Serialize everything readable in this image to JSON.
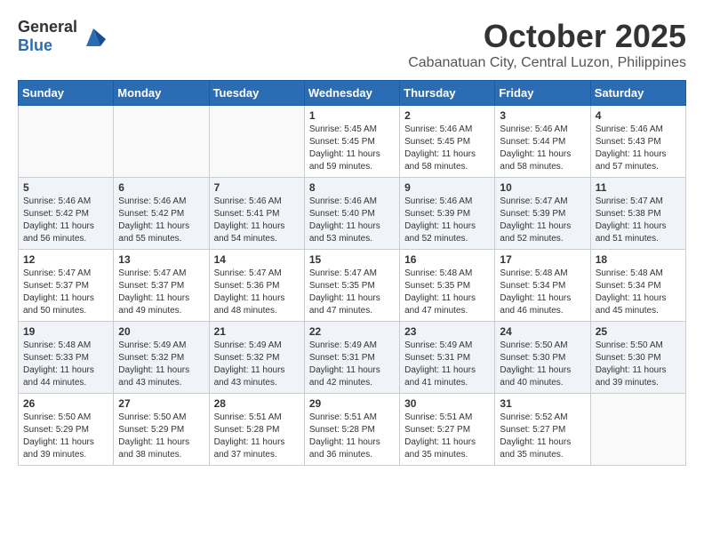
{
  "header": {
    "logo": {
      "general": "General",
      "blue": "Blue"
    },
    "month_title": "October 2025",
    "subtitle": "Cabanatuan City, Central Luzon, Philippines"
  },
  "calendar": {
    "days_of_week": [
      "Sunday",
      "Monday",
      "Tuesday",
      "Wednesday",
      "Thursday",
      "Friday",
      "Saturday"
    ],
    "weeks": [
      [
        {
          "day": "",
          "info": ""
        },
        {
          "day": "",
          "info": ""
        },
        {
          "day": "",
          "info": ""
        },
        {
          "day": "1",
          "info": "Sunrise: 5:45 AM\nSunset: 5:45 PM\nDaylight: 11 hours\nand 59 minutes."
        },
        {
          "day": "2",
          "info": "Sunrise: 5:46 AM\nSunset: 5:45 PM\nDaylight: 11 hours\nand 58 minutes."
        },
        {
          "day": "3",
          "info": "Sunrise: 5:46 AM\nSunset: 5:44 PM\nDaylight: 11 hours\nand 58 minutes."
        },
        {
          "day": "4",
          "info": "Sunrise: 5:46 AM\nSunset: 5:43 PM\nDaylight: 11 hours\nand 57 minutes."
        }
      ],
      [
        {
          "day": "5",
          "info": "Sunrise: 5:46 AM\nSunset: 5:42 PM\nDaylight: 11 hours\nand 56 minutes."
        },
        {
          "day": "6",
          "info": "Sunrise: 5:46 AM\nSunset: 5:42 PM\nDaylight: 11 hours\nand 55 minutes."
        },
        {
          "day": "7",
          "info": "Sunrise: 5:46 AM\nSunset: 5:41 PM\nDaylight: 11 hours\nand 54 minutes."
        },
        {
          "day": "8",
          "info": "Sunrise: 5:46 AM\nSunset: 5:40 PM\nDaylight: 11 hours\nand 53 minutes."
        },
        {
          "day": "9",
          "info": "Sunrise: 5:46 AM\nSunset: 5:39 PM\nDaylight: 11 hours\nand 52 minutes."
        },
        {
          "day": "10",
          "info": "Sunrise: 5:47 AM\nSunset: 5:39 PM\nDaylight: 11 hours\nand 52 minutes."
        },
        {
          "day": "11",
          "info": "Sunrise: 5:47 AM\nSunset: 5:38 PM\nDaylight: 11 hours\nand 51 minutes."
        }
      ],
      [
        {
          "day": "12",
          "info": "Sunrise: 5:47 AM\nSunset: 5:37 PM\nDaylight: 11 hours\nand 50 minutes."
        },
        {
          "day": "13",
          "info": "Sunrise: 5:47 AM\nSunset: 5:37 PM\nDaylight: 11 hours\nand 49 minutes."
        },
        {
          "day": "14",
          "info": "Sunrise: 5:47 AM\nSunset: 5:36 PM\nDaylight: 11 hours\nand 48 minutes."
        },
        {
          "day": "15",
          "info": "Sunrise: 5:47 AM\nSunset: 5:35 PM\nDaylight: 11 hours\nand 47 minutes."
        },
        {
          "day": "16",
          "info": "Sunrise: 5:48 AM\nSunset: 5:35 PM\nDaylight: 11 hours\nand 47 minutes."
        },
        {
          "day": "17",
          "info": "Sunrise: 5:48 AM\nSunset: 5:34 PM\nDaylight: 11 hours\nand 46 minutes."
        },
        {
          "day": "18",
          "info": "Sunrise: 5:48 AM\nSunset: 5:34 PM\nDaylight: 11 hours\nand 45 minutes."
        }
      ],
      [
        {
          "day": "19",
          "info": "Sunrise: 5:48 AM\nSunset: 5:33 PM\nDaylight: 11 hours\nand 44 minutes."
        },
        {
          "day": "20",
          "info": "Sunrise: 5:49 AM\nSunset: 5:32 PM\nDaylight: 11 hours\nand 43 minutes."
        },
        {
          "day": "21",
          "info": "Sunrise: 5:49 AM\nSunset: 5:32 PM\nDaylight: 11 hours\nand 43 minutes."
        },
        {
          "day": "22",
          "info": "Sunrise: 5:49 AM\nSunset: 5:31 PM\nDaylight: 11 hours\nand 42 minutes."
        },
        {
          "day": "23",
          "info": "Sunrise: 5:49 AM\nSunset: 5:31 PM\nDaylight: 11 hours\nand 41 minutes."
        },
        {
          "day": "24",
          "info": "Sunrise: 5:50 AM\nSunset: 5:30 PM\nDaylight: 11 hours\nand 40 minutes."
        },
        {
          "day": "25",
          "info": "Sunrise: 5:50 AM\nSunset: 5:30 PM\nDaylight: 11 hours\nand 39 minutes."
        }
      ],
      [
        {
          "day": "26",
          "info": "Sunrise: 5:50 AM\nSunset: 5:29 PM\nDaylight: 11 hours\nand 39 minutes."
        },
        {
          "day": "27",
          "info": "Sunrise: 5:50 AM\nSunset: 5:29 PM\nDaylight: 11 hours\nand 38 minutes."
        },
        {
          "day": "28",
          "info": "Sunrise: 5:51 AM\nSunset: 5:28 PM\nDaylight: 11 hours\nand 37 minutes."
        },
        {
          "day": "29",
          "info": "Sunrise: 5:51 AM\nSunset: 5:28 PM\nDaylight: 11 hours\nand 36 minutes."
        },
        {
          "day": "30",
          "info": "Sunrise: 5:51 AM\nSunset: 5:27 PM\nDaylight: 11 hours\nand 35 minutes."
        },
        {
          "day": "31",
          "info": "Sunrise: 5:52 AM\nSunset: 5:27 PM\nDaylight: 11 hours\nand 35 minutes."
        },
        {
          "day": "",
          "info": ""
        }
      ]
    ]
  }
}
